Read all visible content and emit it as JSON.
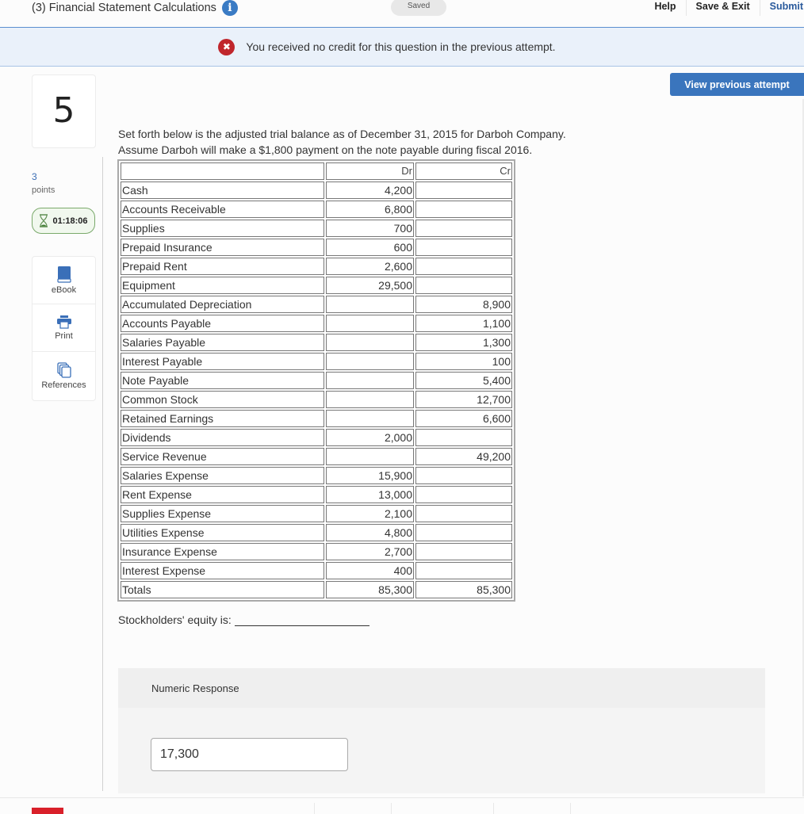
{
  "header": {
    "assignment_title": "(3) Financial Statement Calculations",
    "info_icon": "info-icon",
    "save_status": "Saved",
    "actions": [
      {
        "label": "Help"
      },
      {
        "label": "Save & Exit"
      },
      {
        "label": "Submit"
      }
    ]
  },
  "banner": {
    "icon": "error-x-icon",
    "message": "You received no credit for this question in the previous attempt."
  },
  "view_previous_attempt_label": "View previous attempt",
  "rail": {
    "question_number": "5",
    "points_value": "3",
    "points_label": "points",
    "timer": "01:18:06",
    "tools": [
      {
        "label": "eBook",
        "icon": "book-icon"
      },
      {
        "label": "Print",
        "icon": "printer-icon"
      },
      {
        "label": "References",
        "icon": "copy-documents-icon"
      }
    ]
  },
  "question": {
    "prompt_line1": "Set forth below is the adjusted trial balance as of December 31, 2015 for Darboh Company.",
    "prompt_line2": "Assume Darboh will make a $1,800 payment on the note payable during fiscal 2016.",
    "table": {
      "headers": [
        "",
        "Dr",
        "Cr"
      ],
      "rows": [
        [
          "Cash",
          "4,200",
          ""
        ],
        [
          "Accounts Receivable",
          "6,800",
          ""
        ],
        [
          "Supplies",
          "700",
          ""
        ],
        [
          "Prepaid Insurance",
          "600",
          ""
        ],
        [
          "Prepaid Rent",
          "2,600",
          ""
        ],
        [
          "Equipment",
          "29,500",
          ""
        ],
        [
          "Accumulated Depreciation",
          "",
          "8,900"
        ],
        [
          "Accounts Payable",
          "",
          "1,100"
        ],
        [
          "Salaries Payable",
          "",
          "1,300"
        ],
        [
          "Interest Payable",
          "",
          "100"
        ],
        [
          "Note Payable",
          "",
          "5,400"
        ],
        [
          "Common Stock",
          "",
          "12,700"
        ],
        [
          "Retained Earnings",
          "",
          "6,600"
        ],
        [
          "Dividends",
          "2,000",
          ""
        ],
        [
          "Service Revenue",
          "",
          "49,200"
        ],
        [
          "Salaries Expense",
          "15,900",
          ""
        ],
        [
          "Rent Expense",
          "13,000",
          ""
        ],
        [
          "Supplies Expense",
          "2,100",
          ""
        ],
        [
          "Utilities Expense",
          "4,800",
          ""
        ],
        [
          "Insurance Expense",
          "2,700",
          ""
        ],
        [
          "Interest Expense",
          "400",
          ""
        ],
        [
          "Totals",
          "85,300",
          "85,300"
        ]
      ]
    },
    "equity_prompt": "Stockholders' equity is:"
  },
  "response": {
    "label": "Numeric Response",
    "value": "17,300"
  },
  "colors": {
    "accent_blue": "#3a75bd",
    "error_red": "#c0262c",
    "timer_green": "#7aa96b",
    "banner_bg": "#eaf1fa"
  }
}
